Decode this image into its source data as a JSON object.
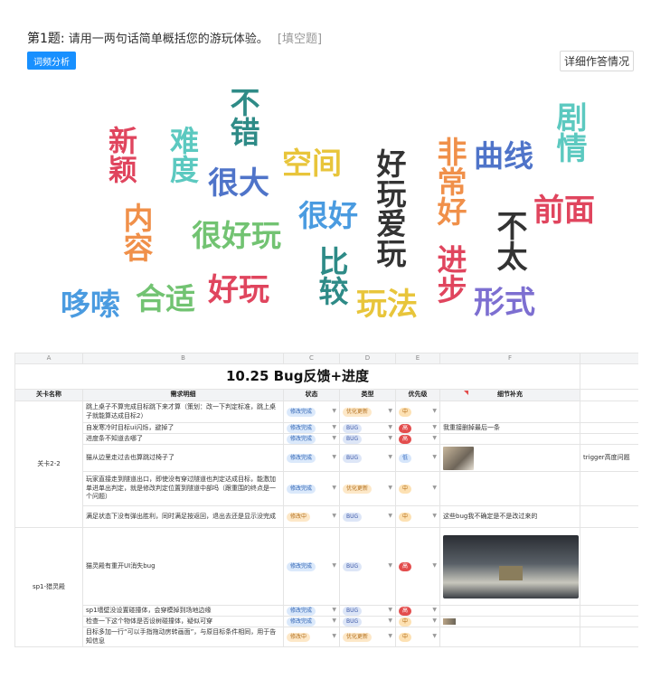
{
  "survey": {
    "question_num": "第1题:",
    "question_text": "请用一两句话简单概括您的游玩体验。",
    "question_type": "[填空题]",
    "analyze_button": "词频分析",
    "detail_button": "详细作答情况"
  },
  "wordcloud": {
    "words": [
      {
        "text": "不错",
        "color": "#2e8b87"
      },
      {
        "text": "新颖",
        "color": "#e0455e"
      },
      {
        "text": "难度",
        "color": "#5cc9c0"
      },
      {
        "text": "很大",
        "color": "#4f74c9"
      },
      {
        "text": "空间",
        "color": "#e8c53b"
      },
      {
        "text": "好玩爱玩",
        "color": "#333333"
      },
      {
        "text": "非常好",
        "color": "#f0904a"
      },
      {
        "text": "曲线",
        "color": "#4f74c9"
      },
      {
        "text": "剧情",
        "color": "#5cc9c0"
      },
      {
        "text": "前面",
        "color": "#e0455e"
      },
      {
        "text": "不太",
        "color": "#333333"
      },
      {
        "text": "内容",
        "color": "#f0904a"
      },
      {
        "text": "很好玩",
        "color": "#72c372"
      },
      {
        "text": "很好",
        "color": "#4a9be0"
      },
      {
        "text": "比较",
        "color": "#2e8b87"
      },
      {
        "text": "进步",
        "color": "#e0455e"
      },
      {
        "text": "哆嗦",
        "color": "#4a9be0"
      },
      {
        "text": "合适",
        "color": "#72c372"
      },
      {
        "text": "好玩",
        "color": "#e0455e"
      },
      {
        "text": "玩法",
        "color": "#e8c53b"
      },
      {
        "text": "形式",
        "color": "#7d6fd1"
      }
    ]
  },
  "sheet": {
    "col_letters": [
      "A",
      "B",
      "C",
      "D",
      "E",
      "F",
      ""
    ],
    "title": "10.25 Bug反馈+进度",
    "headers": [
      "关卡名称",
      "需求明细",
      "状态",
      "类型",
      "优先级",
      "细节补充"
    ],
    "stage_1": "关卡2-2",
    "stage_2": "sp1-猎灵殿",
    "rows": [
      {
        "desc": "跳上桌子不算完成目标跳下来才算（策划：改一下判定标准，跳上桌子就能算达成目标2）",
        "status": "修改完成",
        "type": "优化更新",
        "priority": "中",
        "note": ""
      },
      {
        "desc": "自发寒冷时目标ui闪烁，避掉了",
        "status": "修改完成",
        "type": "BUG",
        "priority": "高",
        "note": "我重接删掉最后一条"
      },
      {
        "desc": "进度条不知道去哪了",
        "status": "修改完成",
        "type": "BUG",
        "priority": "高",
        "note": ""
      },
      {
        "desc": "猫从边里走过去也算跳过椅子了",
        "status": "修改完成",
        "type": "BUG",
        "priority": "低",
        "note": "",
        "extra": "trigger高度问题"
      },
      {
        "desc": "玩家直接走到隧道出口，即使没有穿过隧道也判定达成目标，能激加单进单出判定，就是修改判定位置到隧道中部吗（跟重围的终点是一个问题）",
        "status": "修改完成",
        "type": "优化更新",
        "priority": "中",
        "note": ""
      },
      {
        "desc": "满足状态下没有弹出胜利，同时满足按返回，退出去还是显示没完成",
        "status": "修改中",
        "type": "BUG",
        "priority": "中",
        "note": "这些bug我不确定是不是改过来的"
      },
      {
        "desc": "猫灵殿有重开UI消失bug",
        "status": "修改完成",
        "type": "BUG",
        "priority": "高",
        "note": ""
      },
      {
        "desc": "sp1墙壁没设置碰撞体，会穿模掉到场地边缘",
        "status": "修改完成",
        "type": "BUG",
        "priority": "高",
        "note": ""
      },
      {
        "desc": "检查一下这个物体是否设树碰撞体，疑似可穿",
        "status": "修改完成",
        "type": "BUG",
        "priority": "中",
        "note": ""
      },
      {
        "desc": "目标多加一行“可以手指拖动房转画面”，与原目标条件相同，用于告知信息",
        "status": "修改中",
        "type": "优化更新",
        "priority": "中",
        "note": ""
      }
    ]
  },
  "colors": {
    "accent": "#1890ff",
    "status_done_bg": "#dbe9fb",
    "status_done_fg": "#2d62b3",
    "status_doing_bg": "#fde8c8",
    "status_doing_fg": "#b3701e",
    "type_opt_bg": "#fde8c8",
    "type_opt_fg": "#b3701e",
    "type_bug_bg": "#dde6f7",
    "type_bug_fg": "#3c58a8",
    "prio_high": "#e34d4d",
    "prio_mid_bg": "#fde1b3",
    "prio_mid_fg": "#b36a14",
    "prio_low_bg": "#d6e6fb",
    "prio_low_fg": "#3c6fc1"
  }
}
